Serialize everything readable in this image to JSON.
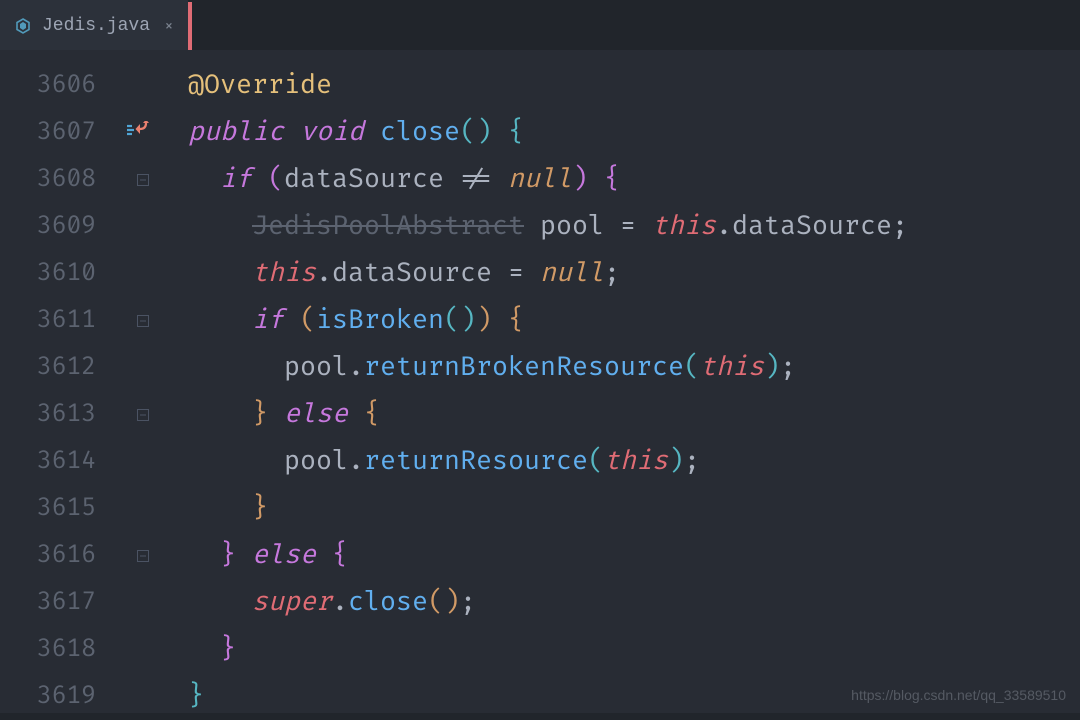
{
  "tab": {
    "filename": "Jedis.java",
    "close_glyph": "×"
  },
  "lines": {
    "start": 3606,
    "numbers": [
      "3606",
      "3607",
      "3608",
      "3609",
      "3610",
      "3611",
      "3612",
      "3613",
      "3614",
      "3615",
      "3616",
      "3617",
      "3618",
      "3619"
    ]
  },
  "code": {
    "l0": {
      "ann": "@Override"
    },
    "l1": {
      "mod": "public",
      "type": "void",
      "fn": "close",
      "par": "()",
      "brace": "{"
    },
    "l2": {
      "ctrl": "if",
      "lp": "(",
      "id1": "dataSource",
      "op": " != ",
      "null": "null",
      "rp": ")",
      "brace": "{"
    },
    "l3": {
      "dep": "JedisPoolAbstract",
      "id1": " pool = ",
      "this": "this",
      "dot": ".",
      "field": "dataSource",
      "semi": ";"
    },
    "l4": {
      "this": "this",
      "dot": ".",
      "field": "dataSource",
      "eq": " = ",
      "null": "null",
      "semi": ";"
    },
    "l5": {
      "ctrl": "if",
      "lp": "(",
      "fn": "isBroken",
      "par": "()",
      "rp": ")",
      "brace": "{"
    },
    "l6": {
      "id": "pool",
      "dot": ".",
      "method": "returnBrokenResource",
      "lp": "(",
      "this": "this",
      "rp": ")",
      "semi": ";"
    },
    "l7": {
      "rbrace": "}",
      "else": "else",
      "lbrace": "{"
    },
    "l8": {
      "id": "pool",
      "dot": ".",
      "method": "returnResource",
      "lp": "(",
      "this": "this",
      "rp": ")",
      "semi": ";"
    },
    "l9": {
      "rbrace": "}"
    },
    "l10": {
      "rbrace": "}",
      "else": "else",
      "lbrace": "{"
    },
    "l11": {
      "super": "super",
      "dot": ".",
      "method": "close",
      "par": "()",
      "semi": ";"
    },
    "l12": {
      "rbrace": "}"
    },
    "l13": {
      "rbrace": "}"
    }
  },
  "watermark": "https://blog.csdn.net/qq_33589510"
}
